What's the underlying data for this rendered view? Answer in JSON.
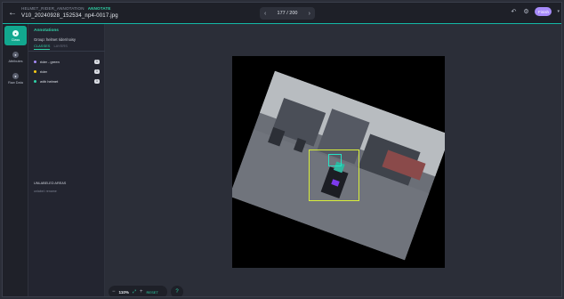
{
  "header": {
    "project": "HELMET_RIDER_ANNOTATION",
    "status": "ANNOTATE",
    "file_name": "V10_20240928_152534_np4-0017.jpg",
    "pager": {
      "current_total": "177 / 200"
    },
    "finish_label": "Finish"
  },
  "rail": {
    "items": [
      {
        "label": "Class",
        "icon": "class-icon"
      },
      {
        "label": "Attributes",
        "icon": "attributes-icon"
      },
      {
        "label": "Raw Data",
        "icon": "raw-data-icon"
      }
    ]
  },
  "panel": {
    "title": "Annotations",
    "subtitle": "Group: helmet rider/noisy",
    "tabs": {
      "classes": "CLASSES",
      "layers": "LAYERS"
    },
    "classes": [
      {
        "label": "rider - green",
        "color": "#a78bfa",
        "count": "1"
      },
      {
        "label": "rider",
        "color": "#facc15",
        "count": "1"
      },
      {
        "label": "with helmet",
        "color": "#2fd3a8",
        "count": "1"
      }
    ],
    "unlabeled_title": "UNLABELED AREAS",
    "unlabeled_note": "unlabel: rename"
  },
  "zoom": {
    "value": "110%",
    "reset": "RESET"
  },
  "colors": {
    "accent": "#14b8a6",
    "bbox_rider": "#d9ef3a",
    "bbox_helmet": "#27e3c6"
  }
}
